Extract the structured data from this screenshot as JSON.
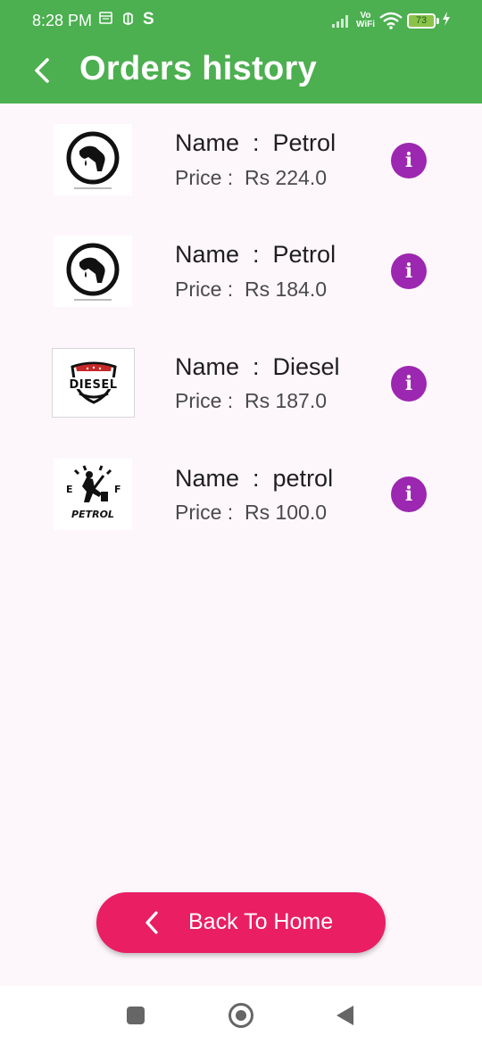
{
  "status_bar": {
    "time": "8:28 PM",
    "carrier_icon": "S",
    "vowifi_top": "Vo",
    "vowifi_bottom": "WiFi",
    "battery": "73"
  },
  "app_bar": {
    "title": "Orders history",
    "back_icon": "chevron-left-icon"
  },
  "orders": [
    {
      "name_label": "Name  :  Petrol",
      "price_label": "Price :  Rs 224.0",
      "image": "fuel-nozzle-icon",
      "info_icon": "info-icon"
    },
    {
      "name_label": "Name  :  Petrol",
      "price_label": "Price :  Rs 184.0",
      "image": "fuel-nozzle-icon",
      "info_icon": "info-icon"
    },
    {
      "name_label": "Name  :  Diesel",
      "price_label": "Price :  Rs 187.0",
      "image": "diesel-badge-logo",
      "badge_text": "DIESEL",
      "info_icon": "info-icon"
    },
    {
      "name_label": "Name  :  petrol",
      "price_label": "Price :  Rs 100.0",
      "image": "fuel-gauge-logo",
      "badge_text": "PETROL",
      "gauge_e": "E",
      "gauge_f": "F",
      "info_icon": "info-icon"
    }
  ],
  "footer": {
    "home_button_label": "Back To Home"
  },
  "colors": {
    "app_bar": "#4caf50",
    "info_button": "#9c27b0",
    "home_button": "#e91e63",
    "background": "#fdf7fc"
  }
}
